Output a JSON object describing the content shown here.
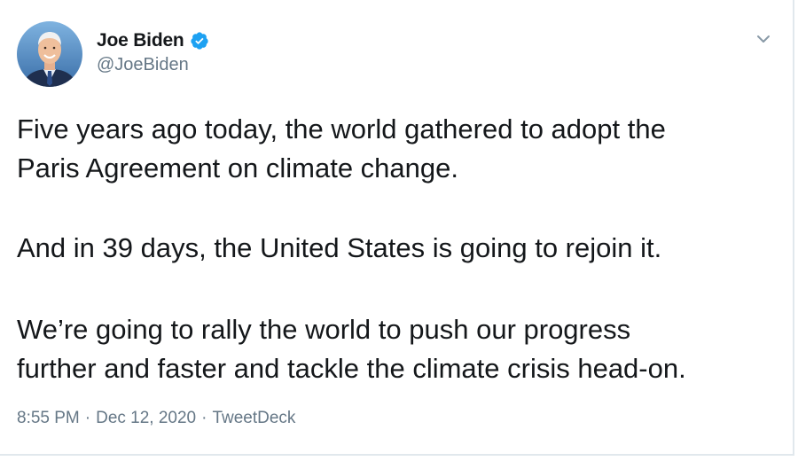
{
  "tweet": {
    "author": {
      "display_name": "Joe Biden",
      "handle": "@JoeBiden",
      "verified": true
    },
    "paragraphs": [
      "Five years ago today, the world gathered to adopt the\nParis Agreement on climate change.",
      "And in 39 days, the United States is going to rejoin it.",
      "We’re going to rally the world to push our progress\nfurther and faster and tackle the climate crisis head-on."
    ],
    "meta": {
      "time": "8:55 PM",
      "separator": "·",
      "date": "Dec 12, 2020",
      "source": "TweetDeck"
    }
  },
  "icons": {
    "verified": "verified-badge-icon",
    "caret": "chevron-down-icon"
  },
  "colors": {
    "text": "#14171a",
    "secondary": "#657786",
    "verified_blue": "#1da1f2",
    "divider": "#e1e8ed"
  }
}
